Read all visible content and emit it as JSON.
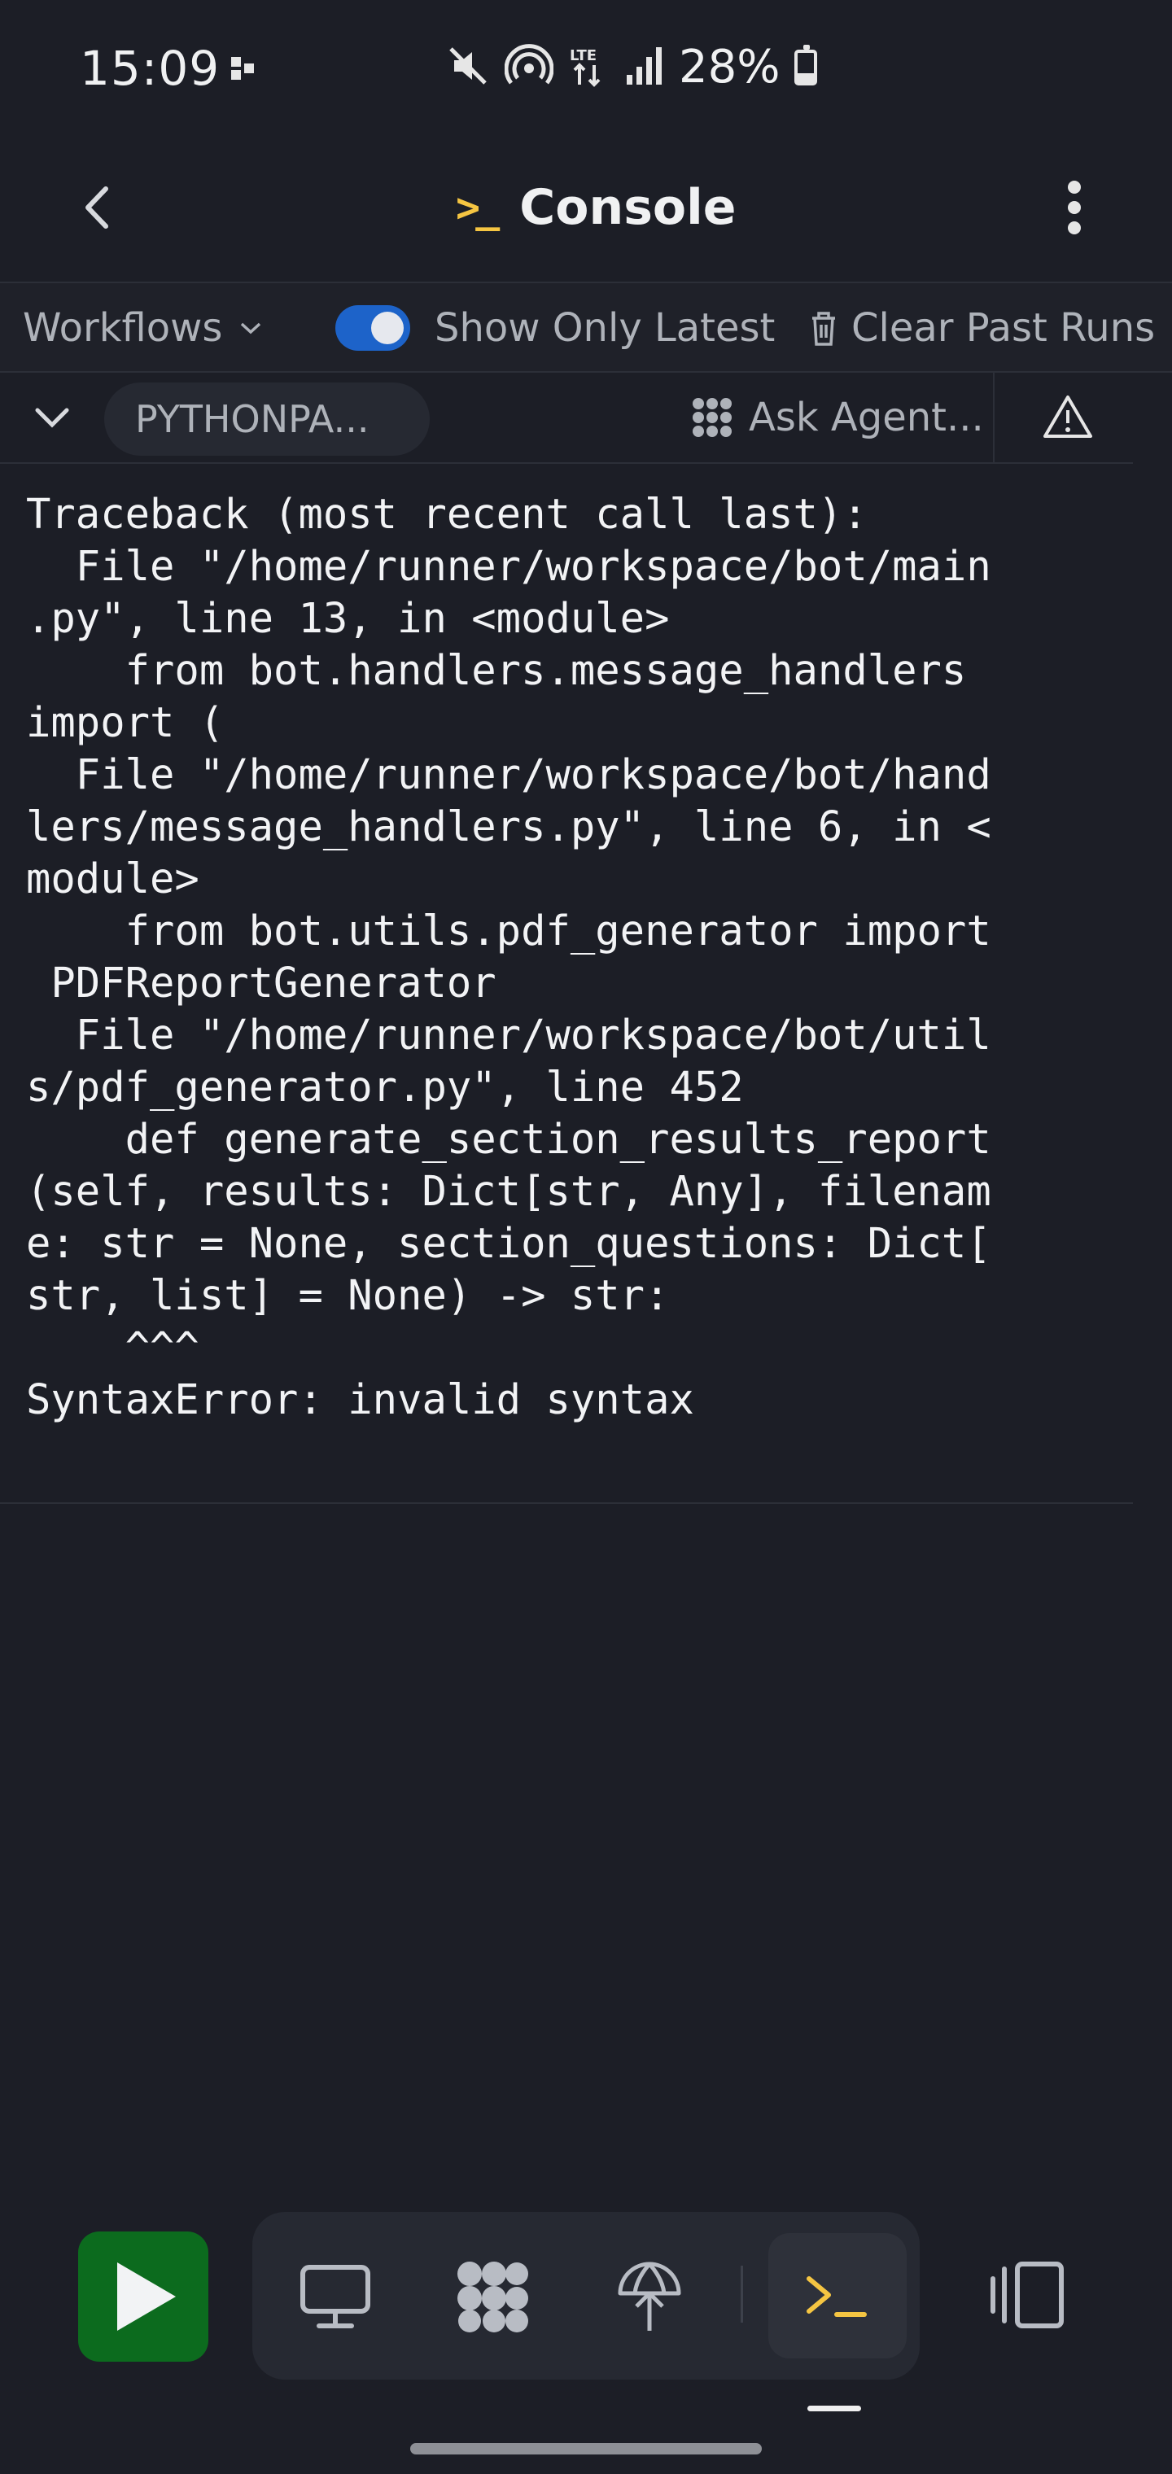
{
  "status_bar": {
    "time": "15:09",
    "network": "LTE",
    "battery_percent": "28%"
  },
  "header": {
    "title": "Console",
    "title_icon": "terminal-icon",
    "accent_color": "#f5c542"
  },
  "toolbar": {
    "workflows_label": "Workflows",
    "show_latest_label": "Show Only Latest",
    "show_latest_on": true,
    "clear_label": "Clear Past Runs",
    "toggle_color": "#1d63c9"
  },
  "run_tab": {
    "pill_label": "PYTHONPA...",
    "ask_agent_label": "Ask Agent..."
  },
  "console": {
    "output": "Traceback (most recent call last):\n  File \"/home/runner/workspace/bot/main\n.py\", line 13, in <module>\n    from bot.handlers.message_handlers\nimport (\n  File \"/home/runner/workspace/bot/hand\nlers/message_handlers.py\", line 6, in <\nmodule>\n    from bot.utils.pdf_generator import\n PDFReportGenerator\n  File \"/home/runner/workspace/bot/util\ns/pdf_generator.py\", line 452\n    def generate_section_results_report\n(self, results: Dict[str, Any], filenam\ne: str = None, section_questions: Dict[\nstr, list] = None) -> str:\n    ^^^\nSyntaxError: invalid syntax"
  },
  "dock": {
    "run_color": "#0c6b1e",
    "icons": [
      "play-icon",
      "monitor-icon",
      "agent-icon",
      "deploy-icon",
      "terminal-icon",
      "panels-icon"
    ]
  }
}
